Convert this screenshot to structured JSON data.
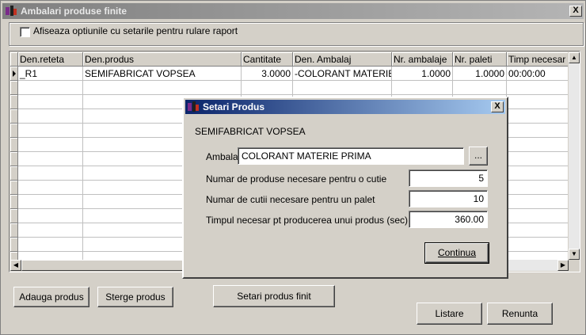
{
  "window": {
    "title": "Ambalari produse finite",
    "close_label": "X"
  },
  "options": {
    "show_settings_label": "Afiseaza optiunile cu setarile pentru rulare raport"
  },
  "grid": {
    "columns": [
      "Den.reteta",
      "Den.produs",
      "Cantitate",
      "Den. Ambalaj",
      "Nr. ambalaje",
      "Nr. paleti",
      "Timp necesar"
    ],
    "rows": [
      [
        "_R1",
        "SEMIFABRICAT VOPSEA",
        "3.0000",
        "-COLORANT MATERIE",
        "1.0000",
        "1.0000",
        "00:00:00"
      ]
    ]
  },
  "buttons": {
    "add": "Adauga produs",
    "delete": "Sterge produs",
    "settings": "Setari produs finit",
    "list": "Listare",
    "cancel": "Renunta"
  },
  "dialog": {
    "title": "Setari Produs",
    "product_name": "SEMIFABRICAT VOPSEA",
    "packaging_label": "Ambalaj",
    "packaging_value": "COLORANT MATERIE PRIMA",
    "browse_label": "...",
    "per_box_label": "Numar de produse necesare pentru o cutie",
    "per_box_value": "5",
    "per_pallet_label": "Numar de cutii necesare pentru un palet",
    "per_pallet_value": "10",
    "time_label": "Timpul necesar pt producerea unui produs (sec)",
    "time_value": "360.00",
    "continue_label": "Continua",
    "close_label": "X"
  }
}
